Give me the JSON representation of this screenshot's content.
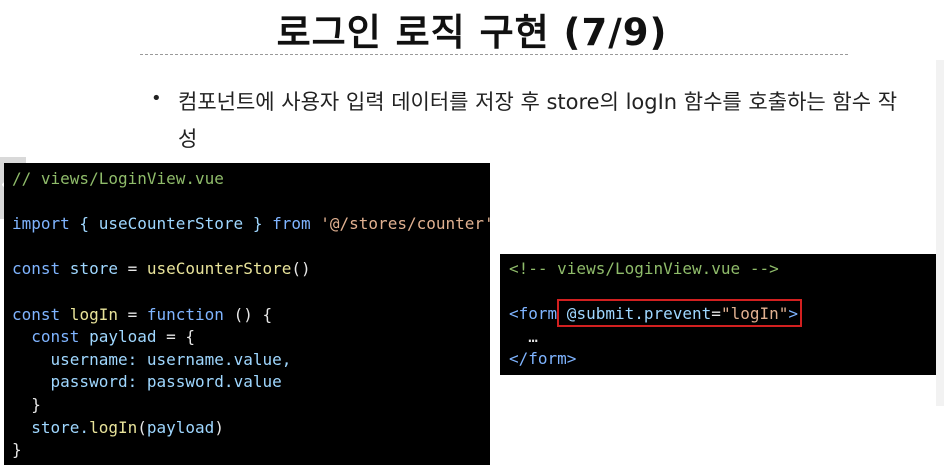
{
  "title": "로그인 로직 구현 (7/9)",
  "bullet": {
    "text": "컴포넌트에 사용자 입력 데이터를 저장 후 store의 logIn 함수를 호출하는 함수 작성"
  },
  "code_left": {
    "comment": "// views/LoginView.vue",
    "import_kw": "import",
    "import_names": " { useCounterStore } ",
    "from_kw": "from",
    "import_path": " '@/stores/counter'",
    "line3_kw": "const",
    "line3_var": " store ",
    "line3_eq": "= ",
    "line3_fn": "useCounterStore",
    "line3_end": "()",
    "line5_kw": "const",
    "line5_var": " logIn ",
    "line5_eq": "= ",
    "line5_fn_kw": "function",
    "line5_end": " () {",
    "line6_indent": "  ",
    "line6_kw": "const",
    "line6_var": " payload ",
    "line6_end": "= {",
    "line7_key": "    username:",
    "line7_val": " username.value,",
    "line8_key": "    password:",
    "line8_val": " password.value",
    "line9": "  }",
    "line10_indent": "  ",
    "line10_obj": "store.",
    "line10_fn": "logIn",
    "line10_open": "(",
    "line10_arg": "payload",
    "line10_close": ")",
    "line11": "}"
  },
  "code_right": {
    "comment": "<!-- views/LoginView.vue -->",
    "tag_open": "<form",
    "attr": " @submit.prevent",
    "attr_eq": "=",
    "attr_val": "\"logIn\"",
    "tag_close": ">",
    "ellipsis": "  …",
    "end_tag": "</form>"
  },
  "colors": {
    "highlight": "#d22020",
    "code_bg": "#000000"
  }
}
